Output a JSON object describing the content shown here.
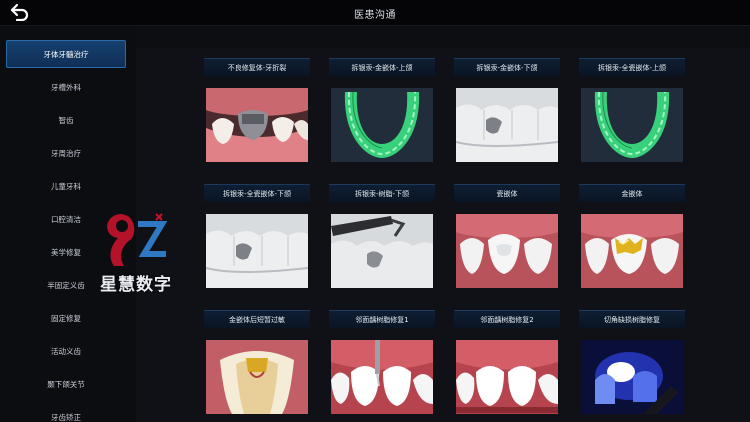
{
  "header": {
    "title": "医患沟通",
    "back_icon": "back-arrow-icon"
  },
  "sidebar": {
    "items": [
      {
        "label": "牙体牙髓治疗",
        "active": true
      },
      {
        "label": "牙槽外科"
      },
      {
        "label": "智齿"
      },
      {
        "label": "牙周治疗"
      },
      {
        "label": "儿童牙科"
      },
      {
        "label": "口腔清洁"
      },
      {
        "label": "美学修复"
      },
      {
        "label": "半固定义齿"
      },
      {
        "label": "固定修复"
      },
      {
        "label": "活动义齿"
      },
      {
        "label": "颞下颌关节"
      },
      {
        "label": "牙齿矫正"
      }
    ]
  },
  "cards": [
    {
      "title": "不良修复体-牙折裂",
      "image": "tooth-fracture"
    },
    {
      "title": "拆银汞-金嵌体-上颌",
      "image": "upper-arch-green"
    },
    {
      "title": "拆银汞-金嵌体-下颌",
      "image": "lower-teeth-gray"
    },
    {
      "title": "拆银汞-全瓷嵌体-上颌",
      "image": "upper-arch-green"
    },
    {
      "title": "拆银汞-全瓷嵌体-下颌",
      "image": "lower-teeth-gray"
    },
    {
      "title": "拆银汞-树脂-下颌",
      "image": "resin-tool"
    },
    {
      "title": "瓷嵌体",
      "image": "porcelain-inlay"
    },
    {
      "title": "金嵌体",
      "image": "gold-inlay"
    },
    {
      "title": "金嵌体后短暂过敏",
      "image": "tooth-section"
    },
    {
      "title": "邻面龋树脂修复1",
      "image": "front-teeth-probe"
    },
    {
      "title": "邻面龋树脂修复2",
      "image": "front-teeth"
    },
    {
      "title": "切角缺损树脂修复",
      "image": "blue-curing-light"
    }
  ],
  "watermark": {
    "text": "星慧数字"
  },
  "colors": {
    "accent": "#2b6aa8",
    "background": "#101116",
    "gum": "#d9747c",
    "tray_green": "#38d07a"
  }
}
